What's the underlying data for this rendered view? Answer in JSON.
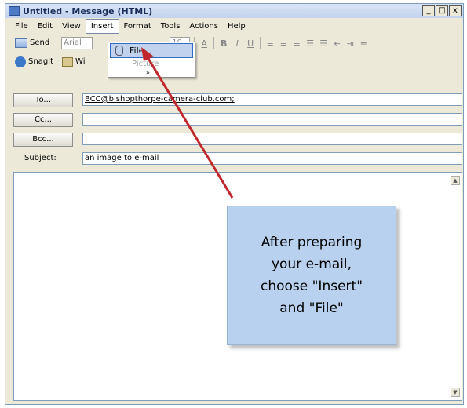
{
  "window": {
    "title": "Untitled - Message (HTML)",
    "controls": [
      "_",
      "□",
      "x"
    ]
  },
  "menubar": {
    "items": [
      "File",
      "Edit",
      "View",
      "Insert",
      "Format",
      "Tools",
      "Actions",
      "Help"
    ],
    "active": "Insert"
  },
  "toolbar1": {
    "send_label": "Send",
    "font_value": "Arial",
    "size_value": "10",
    "format_buttons": [
      "A",
      "B",
      "I",
      "U"
    ]
  },
  "toolbar2": {
    "snagit_label": "SnagIt",
    "window_label": "Wi"
  },
  "insert_menu": {
    "file_label": "File...",
    "picture_label": "Picture",
    "more_label": "»"
  },
  "header": {
    "to_button": "To...",
    "cc_button": "Cc...",
    "bcc_button": "Bcc...",
    "subject_label": "Subject:",
    "to_value": "BCC@bishopthorpe-camera-club.com;",
    "cc_value": "",
    "bcc_value": "",
    "subject_value": "an image to e-mail"
  },
  "callout": {
    "lines": [
      "After preparing",
      "your e-mail,",
      "choose \"Insert\"",
      "and \"File\""
    ]
  },
  "colors": {
    "arrow": "#c0272d",
    "callout_bg": "#b8d1ef",
    "highlight": "#c1d2ee"
  }
}
